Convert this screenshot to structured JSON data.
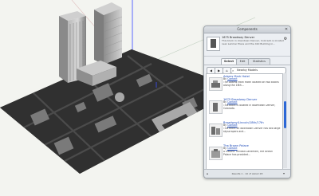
{
  "panel": {
    "title": "Components",
    "model": {
      "title": "1675 Broadway Denver",
      "description": "This block in downtown Denver, Colorado is located near Larimer Place and the 410 Building in..."
    },
    "tabs": [
      {
        "label": "Select",
        "active": true
      },
      {
        "label": "Edit",
        "active": false
      },
      {
        "label": "Statistics",
        "active": false
      }
    ],
    "search": {
      "value": "Nearby Models"
    },
    "results": [
      {
        "title": "Adams Mark Hotel",
        "by_label": "By",
        "author": "Contact",
        "description": "The Adams Mark Hotel located on two blocks along the 16th..."
      },
      {
        "title": "1675 Broadway Denver",
        "by_label": "By",
        "author": "Contact",
        "description": "This block is located in downtown Denver, Colorado."
      },
      {
        "title": "Broadway/Lincoln/18th/17th",
        "by_label": "By",
        "author": "Contact",
        "description": "This block on downtown Denver has two large skyscrapers and..."
      },
      {
        "title": "The Brown Palace",
        "by_label": "By",
        "author": "Contact",
        "description": "A historic Trinidad Landmark, the Brown Palace has provided..."
      }
    ],
    "footer": {
      "text": "Results 1 - 10 of about 28"
    }
  },
  "colors": {
    "accent": "#2c67d6",
    "link": "#1b49b8",
    "panel_bg": "#eceff3"
  },
  "icons": [
    "close-icon",
    "settings-icon",
    "home-icon",
    "back-icon",
    "forward-icon",
    "search-icon",
    "scroll-up-icon",
    "scroll-down-icon"
  ]
}
